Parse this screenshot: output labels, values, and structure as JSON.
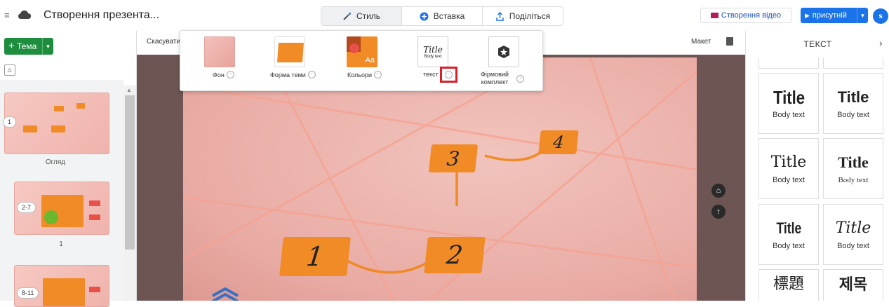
{
  "topbar": {
    "menu_icon": "≡",
    "doc_title": "Створення презента...",
    "tabs": [
      {
        "label": "Стиль",
        "icon": "magic-wand-icon",
        "active": true
      },
      {
        "label": "Вставка",
        "icon": "plus-circle-icon",
        "active": false
      },
      {
        "label": "Поділіться",
        "icon": "share-icon",
        "active": false
      }
    ],
    "record_label": "Створення відео",
    "present_label": "присутній",
    "avatar_initial": "s"
  },
  "left": {
    "theme_button": "Тема",
    "slides": [
      {
        "badge": "1",
        "caption": "Огляд"
      },
      {
        "badge": "2-7",
        "caption": "1"
      },
      {
        "badge": "8-11",
        "caption": ""
      }
    ]
  },
  "stage": {
    "cancel_label": "Скасувати",
    "layout_label": "Макет",
    "boxes": [
      "1",
      "2",
      "3",
      "4"
    ]
  },
  "style_panel": {
    "options": [
      {
        "label": "Фон",
        "icon": "background-thumbnail"
      },
      {
        "label": "Форма теми",
        "icon": "shape-thumbnail"
      },
      {
        "label": "Кольори",
        "icon": "colors-thumbnail",
        "sample": "Aa"
      },
      {
        "label": "текст",
        "icon": "text-style-thumbnail",
        "sample_title": "Title",
        "sample_body": "Body text",
        "highlighted": true
      },
      {
        "label": "Фірмовий комплект",
        "icon": "brand-kit-icon"
      }
    ]
  },
  "right": {
    "header": "ТЕКСТ",
    "cards": [
      {
        "title": "Title",
        "body": "Body text"
      },
      {
        "title": "Title",
        "body": "Body text"
      },
      {
        "title": "Title",
        "body": "Body text"
      },
      {
        "title": "Title",
        "body": "Body text"
      },
      {
        "title": "Title",
        "body": "Body text"
      },
      {
        "title": "Title",
        "body": "Body text",
        "selected": true
      },
      {
        "title": "標題",
        "body": ""
      },
      {
        "title": "제목",
        "body": ""
      }
    ]
  },
  "colors": {
    "accent_blue": "#1a73e8",
    "theme_green": "#1e8e3e",
    "box_orange": "#f18b26",
    "highlight_red": "#d81e2a"
  }
}
